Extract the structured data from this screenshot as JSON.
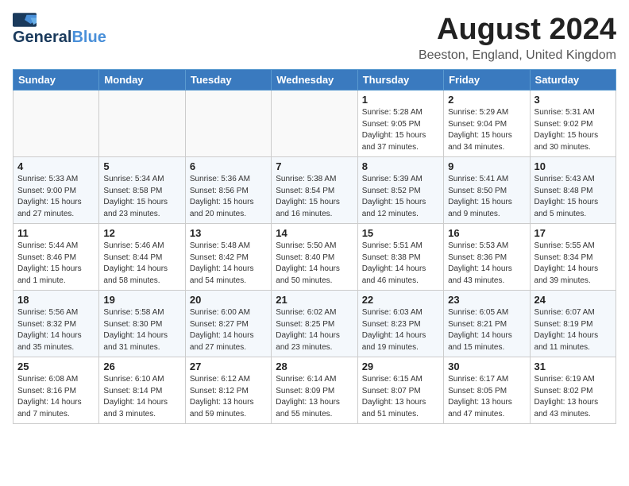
{
  "header": {
    "logo_general": "General",
    "logo_blue": "Blue",
    "month": "August 2024",
    "location": "Beeston, England, United Kingdom"
  },
  "weekdays": [
    "Sunday",
    "Monday",
    "Tuesday",
    "Wednesday",
    "Thursday",
    "Friday",
    "Saturday"
  ],
  "weeks": [
    [
      {
        "day": "",
        "info": ""
      },
      {
        "day": "",
        "info": ""
      },
      {
        "day": "",
        "info": ""
      },
      {
        "day": "",
        "info": ""
      },
      {
        "day": "1",
        "info": "Sunrise: 5:28 AM\nSunset: 9:05 PM\nDaylight: 15 hours\nand 37 minutes."
      },
      {
        "day": "2",
        "info": "Sunrise: 5:29 AM\nSunset: 9:04 PM\nDaylight: 15 hours\nand 34 minutes."
      },
      {
        "day": "3",
        "info": "Sunrise: 5:31 AM\nSunset: 9:02 PM\nDaylight: 15 hours\nand 30 minutes."
      }
    ],
    [
      {
        "day": "4",
        "info": "Sunrise: 5:33 AM\nSunset: 9:00 PM\nDaylight: 15 hours\nand 27 minutes."
      },
      {
        "day": "5",
        "info": "Sunrise: 5:34 AM\nSunset: 8:58 PM\nDaylight: 15 hours\nand 23 minutes."
      },
      {
        "day": "6",
        "info": "Sunrise: 5:36 AM\nSunset: 8:56 PM\nDaylight: 15 hours\nand 20 minutes."
      },
      {
        "day": "7",
        "info": "Sunrise: 5:38 AM\nSunset: 8:54 PM\nDaylight: 15 hours\nand 16 minutes."
      },
      {
        "day": "8",
        "info": "Sunrise: 5:39 AM\nSunset: 8:52 PM\nDaylight: 15 hours\nand 12 minutes."
      },
      {
        "day": "9",
        "info": "Sunrise: 5:41 AM\nSunset: 8:50 PM\nDaylight: 15 hours\nand 9 minutes."
      },
      {
        "day": "10",
        "info": "Sunrise: 5:43 AM\nSunset: 8:48 PM\nDaylight: 15 hours\nand 5 minutes."
      }
    ],
    [
      {
        "day": "11",
        "info": "Sunrise: 5:44 AM\nSunset: 8:46 PM\nDaylight: 15 hours\nand 1 minute."
      },
      {
        "day": "12",
        "info": "Sunrise: 5:46 AM\nSunset: 8:44 PM\nDaylight: 14 hours\nand 58 minutes."
      },
      {
        "day": "13",
        "info": "Sunrise: 5:48 AM\nSunset: 8:42 PM\nDaylight: 14 hours\nand 54 minutes."
      },
      {
        "day": "14",
        "info": "Sunrise: 5:50 AM\nSunset: 8:40 PM\nDaylight: 14 hours\nand 50 minutes."
      },
      {
        "day": "15",
        "info": "Sunrise: 5:51 AM\nSunset: 8:38 PM\nDaylight: 14 hours\nand 46 minutes."
      },
      {
        "day": "16",
        "info": "Sunrise: 5:53 AM\nSunset: 8:36 PM\nDaylight: 14 hours\nand 43 minutes."
      },
      {
        "day": "17",
        "info": "Sunrise: 5:55 AM\nSunset: 8:34 PM\nDaylight: 14 hours\nand 39 minutes."
      }
    ],
    [
      {
        "day": "18",
        "info": "Sunrise: 5:56 AM\nSunset: 8:32 PM\nDaylight: 14 hours\nand 35 minutes."
      },
      {
        "day": "19",
        "info": "Sunrise: 5:58 AM\nSunset: 8:30 PM\nDaylight: 14 hours\nand 31 minutes."
      },
      {
        "day": "20",
        "info": "Sunrise: 6:00 AM\nSunset: 8:27 PM\nDaylight: 14 hours\nand 27 minutes."
      },
      {
        "day": "21",
        "info": "Sunrise: 6:02 AM\nSunset: 8:25 PM\nDaylight: 14 hours\nand 23 minutes."
      },
      {
        "day": "22",
        "info": "Sunrise: 6:03 AM\nSunset: 8:23 PM\nDaylight: 14 hours\nand 19 minutes."
      },
      {
        "day": "23",
        "info": "Sunrise: 6:05 AM\nSunset: 8:21 PM\nDaylight: 14 hours\nand 15 minutes."
      },
      {
        "day": "24",
        "info": "Sunrise: 6:07 AM\nSunset: 8:19 PM\nDaylight: 14 hours\nand 11 minutes."
      }
    ],
    [
      {
        "day": "25",
        "info": "Sunrise: 6:08 AM\nSunset: 8:16 PM\nDaylight: 14 hours\nand 7 minutes."
      },
      {
        "day": "26",
        "info": "Sunrise: 6:10 AM\nSunset: 8:14 PM\nDaylight: 14 hours\nand 3 minutes."
      },
      {
        "day": "27",
        "info": "Sunrise: 6:12 AM\nSunset: 8:12 PM\nDaylight: 13 hours\nand 59 minutes."
      },
      {
        "day": "28",
        "info": "Sunrise: 6:14 AM\nSunset: 8:09 PM\nDaylight: 13 hours\nand 55 minutes."
      },
      {
        "day": "29",
        "info": "Sunrise: 6:15 AM\nSunset: 8:07 PM\nDaylight: 13 hours\nand 51 minutes."
      },
      {
        "day": "30",
        "info": "Sunrise: 6:17 AM\nSunset: 8:05 PM\nDaylight: 13 hours\nand 47 minutes."
      },
      {
        "day": "31",
        "info": "Sunrise: 6:19 AM\nSunset: 8:02 PM\nDaylight: 13 hours\nand 43 minutes."
      }
    ]
  ]
}
